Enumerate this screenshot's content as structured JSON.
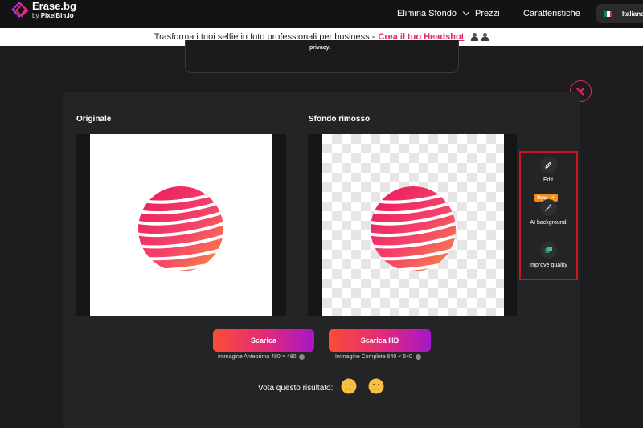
{
  "header": {
    "brand": {
      "title": "Erase.bg",
      "by_prefix": "by",
      "by_name": "PixelBin.io"
    },
    "nav": [
      {
        "label": "Elimina Sfondo",
        "has_dropdown": true
      },
      {
        "label": "Prezzi"
      },
      {
        "label": "Caratteristiche"
      }
    ],
    "language": {
      "label": "Italiano",
      "flag_colors": [
        "#009246",
        "#ffffff",
        "#ce2b37"
      ]
    }
  },
  "banner": {
    "text": "Trasforma i tuoi selfie in foto professionali per business -",
    "link": "Crea il tuo Headshot"
  },
  "background_card": {
    "text": "privacy."
  },
  "modal": {
    "original_title": "Originale",
    "removed_title": "Sfondo rimosso",
    "tools": [
      {
        "label": "Edit",
        "icon": "pencil-icon"
      },
      {
        "label": "AI background",
        "icon": "magic-wand-icon",
        "badge": "New ✨"
      },
      {
        "label": "Improve quality",
        "icon": "enhance-icon"
      }
    ],
    "downloads": [
      {
        "label": "Scarica",
        "caption": "Immagine Anteprima 480 × 480"
      },
      {
        "label": "Scarica HD",
        "caption": "Immagine Completa 640 × 640"
      }
    ],
    "rating": {
      "label": "Vota questo risultato:"
    }
  },
  "colors": {
    "accent": "#e5265f",
    "highlight_border": "#d0141f",
    "button_gradient": [
      "#fa4d36",
      "#e1287d",
      "#a418c9"
    ],
    "badge": "#f28a1e"
  }
}
